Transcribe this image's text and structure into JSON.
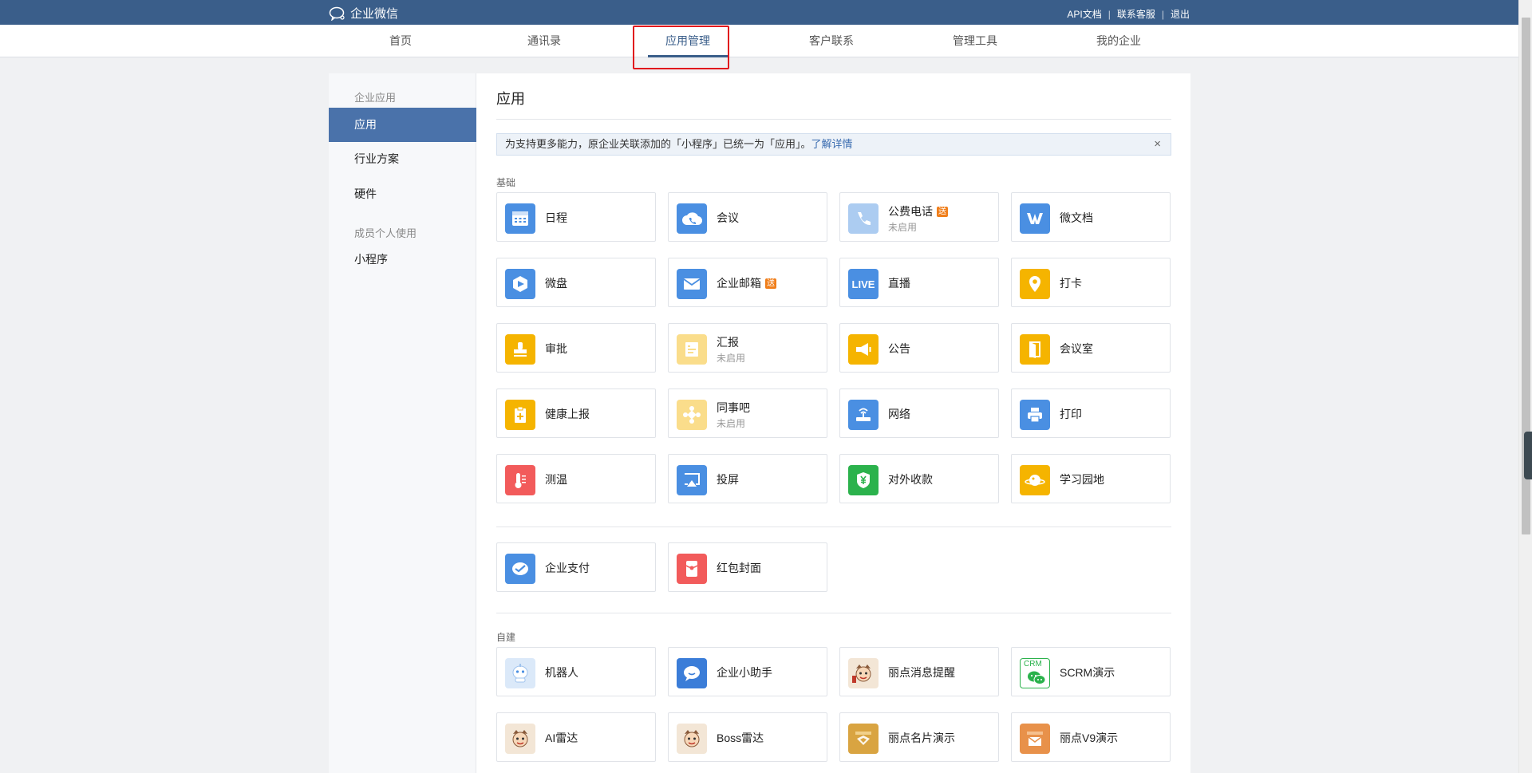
{
  "topbar": {
    "logo_text": "企业微信",
    "links": [
      "API文档",
      "联系客服",
      "退出"
    ]
  },
  "nav": {
    "tabs": [
      "首页",
      "通讯录",
      "应用管理",
      "客户联系",
      "管理工具",
      "我的企业"
    ],
    "active": "应用管理"
  },
  "sidebar": {
    "group1_title": "企业应用",
    "group1_items": [
      "应用",
      "行业方案",
      "硬件"
    ],
    "group2_title": "成员个人使用",
    "group2_items": [
      "小程序"
    ]
  },
  "content": {
    "title": "应用",
    "notice": {
      "text": "为支持更多能力，原企业关联添加的「小程序」已统一为「应用」。",
      "link": "了解详情",
      "close": "×"
    },
    "basic_label": "基础",
    "custom_label": "自建",
    "basic_apps": [
      {
        "name": "日程",
        "sub": "",
        "badge": ""
      },
      {
        "name": "会议",
        "sub": "",
        "badge": ""
      },
      {
        "name": "公费电话",
        "sub": "未启用",
        "badge": "送"
      },
      {
        "name": "微文档",
        "sub": "",
        "badge": ""
      },
      {
        "name": "微盘",
        "sub": "",
        "badge": ""
      },
      {
        "name": "企业邮箱",
        "sub": "",
        "badge": "送"
      },
      {
        "name": "直播",
        "sub": "",
        "badge": ""
      },
      {
        "name": "打卡",
        "sub": "",
        "badge": ""
      },
      {
        "name": "审批",
        "sub": "",
        "badge": ""
      },
      {
        "name": "汇报",
        "sub": "未启用",
        "badge": ""
      },
      {
        "name": "公告",
        "sub": "",
        "badge": ""
      },
      {
        "name": "会议室",
        "sub": "",
        "badge": ""
      },
      {
        "name": "健康上报",
        "sub": "",
        "badge": ""
      },
      {
        "name": "同事吧",
        "sub": "未启用",
        "badge": ""
      },
      {
        "name": "网络",
        "sub": "",
        "badge": ""
      },
      {
        "name": "打印",
        "sub": "",
        "badge": ""
      },
      {
        "name": "测温",
        "sub": "",
        "badge": ""
      },
      {
        "name": "投屏",
        "sub": "",
        "badge": ""
      },
      {
        "name": "对外收款",
        "sub": "",
        "badge": ""
      },
      {
        "name": "学习园地",
        "sub": "",
        "badge": ""
      }
    ],
    "pay_apps": [
      {
        "name": "企业支付"
      },
      {
        "name": "红包封面"
      }
    ],
    "custom_apps": [
      {
        "name": "机器人"
      },
      {
        "name": "企业小助手"
      },
      {
        "name": "丽点消息提醒"
      },
      {
        "name": "SCRM演示"
      },
      {
        "name": "AI雷达"
      },
      {
        "name": "Boss雷达"
      },
      {
        "name": "丽点名片演示"
      },
      {
        "name": "丽点V9演示"
      }
    ],
    "icon_text": {
      "live": "LIVE",
      "crm": "CRM"
    }
  },
  "colors": {
    "topbar": "#3a5e8a",
    "sidebar_active": "#4a72aa",
    "blue_icon": "#4a8fe2",
    "yellow_icon": "#f5b400",
    "red_icon": "#f25b5b",
    "green_icon": "#2bb24c",
    "badge": "#f07e1a",
    "highlight": "#e1161d"
  }
}
